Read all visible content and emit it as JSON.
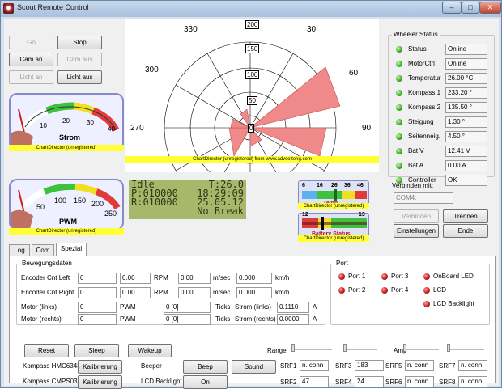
{
  "window": {
    "title": "Scout Remote Control"
  },
  "controls": {
    "go": "Go",
    "stop": "Stop",
    "cam_an": "Cam an",
    "cam_aus": "Cam aus",
    "licht_an": "Licht an",
    "licht_aus": "Licht aus"
  },
  "gauge_strom": {
    "label": "Strom",
    "ticks": [
      "10",
      "20",
      "30",
      "40"
    ],
    "watermark": "ChartDirector (unregistered)",
    "needle_fraction": 0.0
  },
  "gauge_pwm": {
    "label": "PWM",
    "ticks": [
      "50",
      "100",
      "150",
      "200",
      "250"
    ],
    "watermark": "ChartDirector (unregistered)",
    "needle_fraction": 0.0
  },
  "polar": {
    "angle_labels": [
      "330",
      "30",
      "300",
      "60",
      "270",
      "90"
    ],
    "radial_labels": [
      "200",
      "150",
      "100",
      "50",
      "0"
    ],
    "watermark": "ChartDirector (unregistered) from www.advsofteng.com"
  },
  "lcd": {
    "line1_left": "Idle",
    "line1_right": "T:26.0",
    "line2_left": "P:010000",
    "line2_right": "18:29:09",
    "line3_left": "R:010000",
    "line3_right": "25.05.12",
    "line4_right": "No Break"
  },
  "temp_gauge": {
    "ticks": [
      "6",
      "16",
      "26",
      "36",
      "46"
    ],
    "label": "Temp",
    "watermark": "ChartDirector (unregistered)",
    "value": 26.0
  },
  "battery_gauge": {
    "ticks": [
      "12",
      "13"
    ],
    "label": "Battery Status",
    "watermark": "ChartDirector (unregistered)",
    "value": 12.41
  },
  "wheeler": {
    "title": "Wheeler Status",
    "rows": [
      {
        "label": "Status",
        "value": "Online"
      },
      {
        "label": "MotorCtrl",
        "value": "Online"
      },
      {
        "label": "Temperatur",
        "value": "26.00 °C"
      },
      {
        "label": "Kompass 1",
        "value": "233.20 °"
      },
      {
        "label": "Kompass 2",
        "value": "135.50 °"
      },
      {
        "label": "Steigung",
        "value": "1.30 °"
      },
      {
        "label": "Seitenneig.",
        "value": "4.50 °"
      },
      {
        "label": "Bat V",
        "value": "12.41 V"
      },
      {
        "label": "Bat A",
        "value": "0.00 A"
      },
      {
        "label": "Controller",
        "value": "OK"
      }
    ]
  },
  "connect": {
    "label": "Verbinden mit:",
    "port": "COM4:",
    "verbinden": "Verbinden",
    "trennen": "Trennen",
    "einstellungen": "Einstellungen",
    "ende": "Ende"
  },
  "tabs": [
    "Log",
    "Com",
    "Spezial"
  ],
  "bewegung": {
    "title": "Bewegungsdaten",
    "rows": [
      {
        "label": "Encoder Cnt Left",
        "v1": "0",
        "v2": "0.00",
        "unit2": "RPM",
        "v3": "0.00",
        "unit3": "m/sec",
        "v4": "0.000",
        "unit4": "km/h"
      },
      {
        "label": "Encoder Cnt Right",
        "v1": "0",
        "v2": "0.00",
        "unit2": "RPM",
        "v3": "0.00",
        "unit3": "m/sec",
        "v4": "0.000",
        "unit4": "km/h"
      }
    ],
    "motor": [
      {
        "label": "Motor (links)",
        "v1": "0",
        "unit1": "PWM",
        "v2": "0 [0]",
        "unit2": "Ticks",
        "label3": "Strom (links)",
        "v3": "0.1110",
        "unit3": "A"
      },
      {
        "label": "Motor (rechts)",
        "v1": "0",
        "unit1": "PWM",
        "v2": "0 [0]",
        "unit2": "Ticks",
        "label3": "Strom (rechts)",
        "v3": "0.0000",
        "unit3": "A"
      }
    ]
  },
  "port": {
    "title": "Port",
    "items": [
      "Port 1",
      "Port 3",
      "OnBoard LED",
      "Port 2",
      "Port 4",
      "LCD",
      "LCD Backlight"
    ]
  },
  "bottom": {
    "reset": "Reset",
    "sleep": "Sleep",
    "wakeup": "Wakeup",
    "kompass1": "Kompass HMC6343",
    "kompass2": "Kompass CMPS03",
    "kalibrierung": "Kalibrierung",
    "beeper": "Beeper",
    "beep": "Beep",
    "sound": "Sound",
    "lcd_backlight": "LCD Backlight",
    "on": "On",
    "range": "Range",
    "amp": "Amp"
  },
  "srf": [
    {
      "label": "SRF1",
      "value": "n. conn"
    },
    {
      "label": "SRF3",
      "value": "183"
    },
    {
      "label": "SRF5",
      "value": "n. conn"
    },
    {
      "label": "SRF7",
      "value": "n. conn"
    },
    {
      "label": "SRF2",
      "value": "47"
    },
    {
      "label": "SRF4",
      "value": "24"
    },
    {
      "label": "SRF6",
      "value": "n. conn"
    },
    {
      "label": "SRF8",
      "value": "n. conn"
    }
  ]
}
